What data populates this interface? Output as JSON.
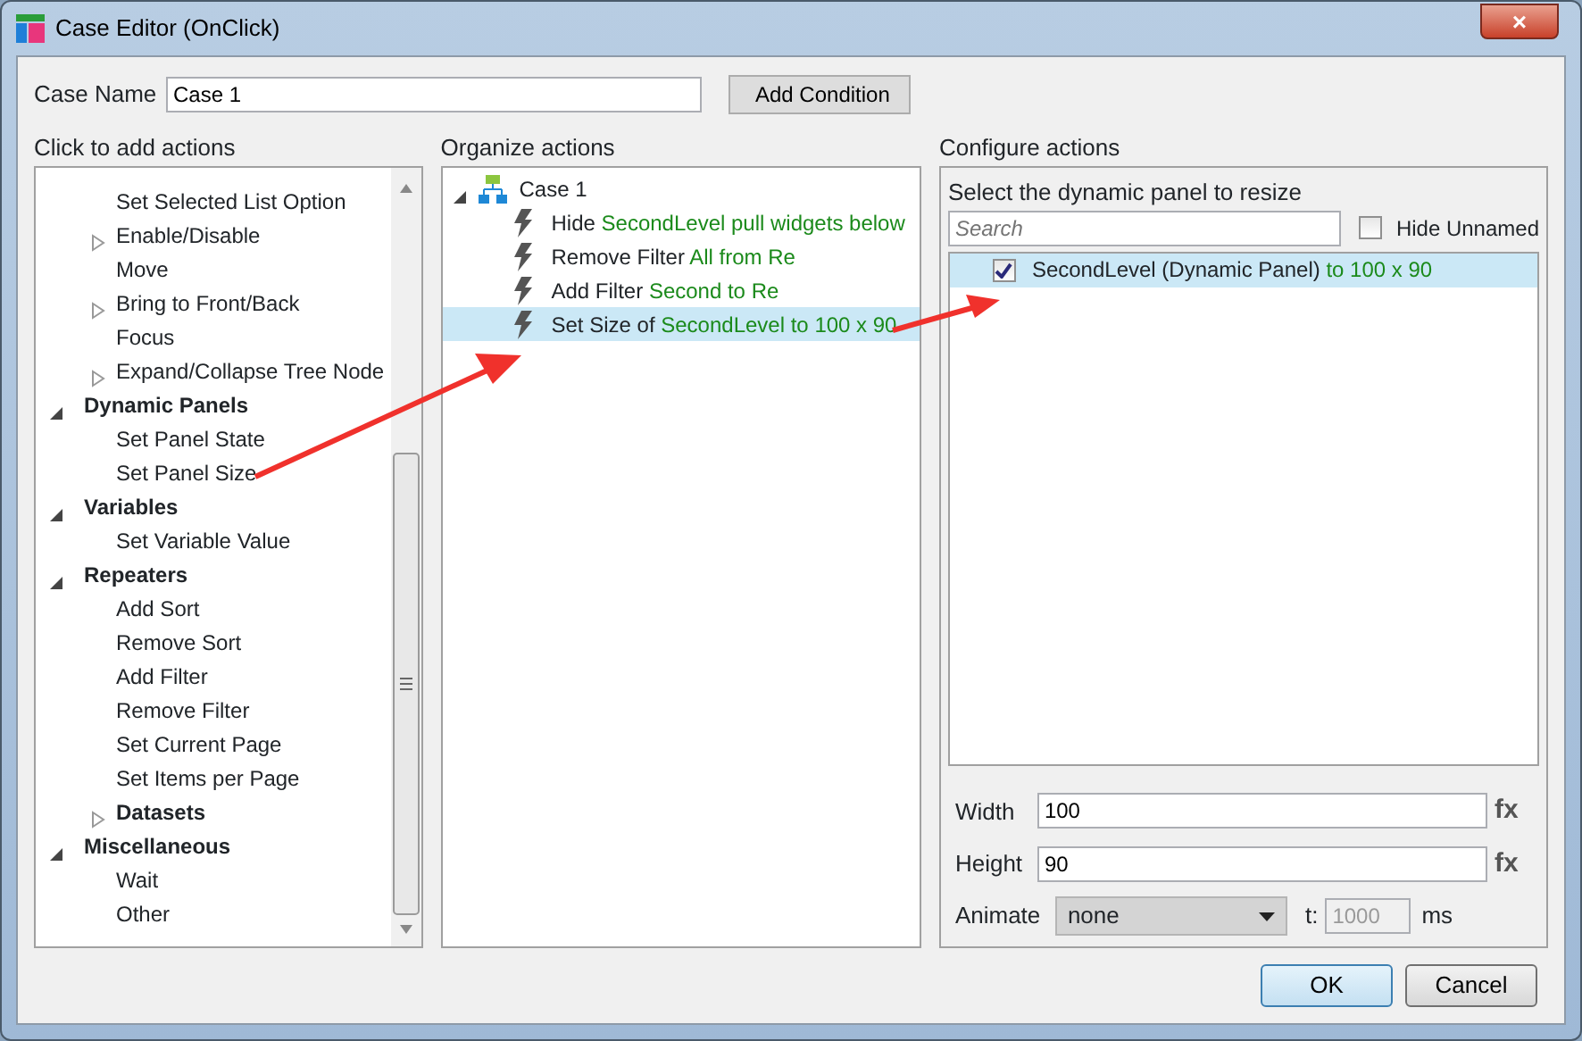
{
  "window": {
    "title": "Case Editor (OnClick)",
    "close_label": "×"
  },
  "case_name": {
    "label": "Case Name",
    "value": "Case 1"
  },
  "add_condition": "Add Condition",
  "actions_panel": {
    "heading": "Click to add actions",
    "continued_items": [
      {
        "label": "Set Selected List Option",
        "kind": "action"
      },
      {
        "label": "Enable/Disable",
        "kind": "folder",
        "expanded": false
      },
      {
        "label": "Move",
        "kind": "action"
      },
      {
        "label": "Bring to Front/Back",
        "kind": "folder",
        "expanded": false
      },
      {
        "label": "Focus",
        "kind": "action"
      },
      {
        "label": "Expand/Collapse Tree Node",
        "kind": "folder",
        "expanded": false
      }
    ],
    "categories": [
      {
        "label": "Dynamic Panels",
        "expanded": true,
        "children": [
          {
            "label": "Set Panel State",
            "kind": "action"
          },
          {
            "label": "Set Panel Size",
            "kind": "action"
          }
        ]
      },
      {
        "label": "Variables",
        "expanded": true,
        "children": [
          {
            "label": "Set Variable Value",
            "kind": "action"
          }
        ]
      },
      {
        "label": "Repeaters",
        "expanded": true,
        "children": [
          {
            "label": "Add Sort",
            "kind": "action"
          },
          {
            "label": "Remove Sort",
            "kind": "action"
          },
          {
            "label": "Add Filter",
            "kind": "action"
          },
          {
            "label": "Remove Filter",
            "kind": "action"
          },
          {
            "label": "Set Current Page",
            "kind": "action"
          },
          {
            "label": "Set Items per Page",
            "kind": "action"
          },
          {
            "label": "Datasets",
            "kind": "group",
            "expanded": false
          }
        ]
      },
      {
        "label": "Miscellaneous",
        "expanded": true,
        "children": [
          {
            "label": "Wait",
            "kind": "action"
          },
          {
            "label": "Other",
            "kind": "action"
          }
        ]
      }
    ]
  },
  "organize_panel": {
    "heading": "Organize actions",
    "case": {
      "label": "Case 1",
      "expanded": true,
      "children": [
        {
          "verb": "Hide",
          "detail": "SecondLevel pull widgets below",
          "selected": false
        },
        {
          "verb": "Remove Filter",
          "detail": "All from Re",
          "selected": false
        },
        {
          "verb": "Add Filter",
          "detail": "Second to Re",
          "selected": false
        },
        {
          "verb": "Set Size of",
          "detail": "SecondLevel to 100 x 90",
          "selected": true
        }
      ]
    }
  },
  "configure_panel": {
    "heading": "Configure actions",
    "prompt": "Select the dynamic panel to resize",
    "search": {
      "placeholder": "Search"
    },
    "hide_unnamed": {
      "label": "Hide Unnamed",
      "checked": false
    },
    "panels": [
      {
        "name": "SecondLevel (Dynamic Panel)",
        "detail": "to 100 x 90",
        "checked": true,
        "selected": true
      }
    ],
    "width": {
      "label": "Width",
      "value": "100",
      "fx": "fx"
    },
    "height": {
      "label": "Height",
      "value": "90",
      "fx": "fx"
    },
    "animate": {
      "label": "Animate",
      "value": "none",
      "t_label": "t:",
      "duration": "1000",
      "unit": "ms",
      "disabled": true
    }
  },
  "buttons": [
    {
      "label": "OK",
      "default": true
    },
    {
      "label": "Cancel",
      "default": false
    }
  ]
}
